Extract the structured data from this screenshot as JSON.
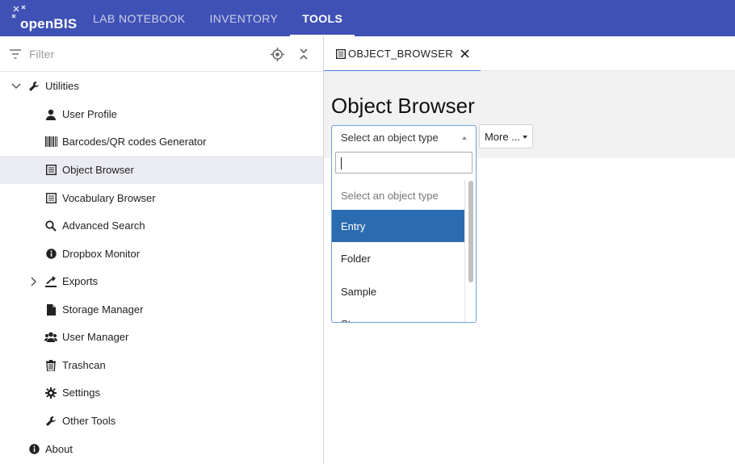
{
  "app": {
    "logo_text": "openBIS",
    "nav": [
      {
        "label": "LAB NOTEBOOK",
        "active": false
      },
      {
        "label": "INVENTORY",
        "active": false
      },
      {
        "label": "TOOLS",
        "active": true
      }
    ]
  },
  "sidebar": {
    "filter_placeholder": "Filter",
    "root": {
      "label": "Utilities",
      "icon": "wrench-icon",
      "expanded": true
    },
    "items": [
      {
        "label": "User Profile",
        "icon": "user-icon"
      },
      {
        "label": "Barcodes/QR codes Generator",
        "icon": "barcode-icon"
      },
      {
        "label": "Object Browser",
        "icon": "table-icon",
        "selected": true
      },
      {
        "label": "Vocabulary Browser",
        "icon": "table-icon"
      },
      {
        "label": "Advanced Search",
        "icon": "search-icon"
      },
      {
        "label": "Dropbox Monitor",
        "icon": "info-icon"
      },
      {
        "label": "Exports",
        "icon": "export-icon",
        "expandable": true
      },
      {
        "label": "Storage Manager",
        "icon": "file-icon"
      },
      {
        "label": "User Manager",
        "icon": "users-icon"
      },
      {
        "label": "Trashcan",
        "icon": "trash-icon"
      },
      {
        "label": "Settings",
        "icon": "gear-icon"
      },
      {
        "label": "Other Tools",
        "icon": "wrench-icon"
      }
    ],
    "about": {
      "label": "About",
      "icon": "info-icon"
    }
  },
  "main": {
    "tab": {
      "label": "OBJECT_BROWSER",
      "icon": "table-icon"
    },
    "title": "Object Browser",
    "select": {
      "value": "Select an object type"
    },
    "more_button": "More ...",
    "dropdown": {
      "search_value": "",
      "options": [
        {
          "label": "Select an object type",
          "placeholder": true
        },
        {
          "label": "Entry",
          "highlighted": true
        },
        {
          "label": "Folder"
        },
        {
          "label": "Sample"
        },
        {
          "label": "Storage"
        }
      ]
    }
  },
  "colors": {
    "topbar": "#3f51b5",
    "selected_row": "#ebebf3",
    "highlight": "#2b6cb0",
    "tab_underline": "#3f7dd8"
  }
}
